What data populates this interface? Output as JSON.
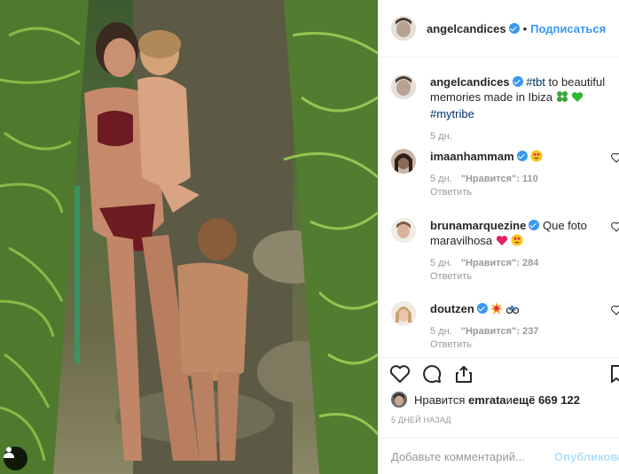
{
  "header": {
    "username": "angelcandices",
    "follow_label": "Подписаться",
    "separator": "•"
  },
  "caption": {
    "username": "angelcandices",
    "text_a": "#tbt",
    "text_b": " to beautiful memories made in Ibiza",
    "text_c": "#mytribe",
    "time": "5 дн."
  },
  "comments": [
    {
      "username": "imaanhammam",
      "text": "",
      "time": "5 дн.",
      "likes": "\"Нравится\": 110",
      "reply": "Ответить"
    },
    {
      "username": "brunamarquezine",
      "text": "Que foto maravilhosa",
      "time": "5 дн.",
      "likes": "\"Нравится\": 284",
      "reply": "Ответить"
    },
    {
      "username": "doutzen",
      "text": "",
      "time": "5 дн.",
      "likes": "\"Нравится\": 237",
      "reply": "Ответить"
    }
  ],
  "likes": {
    "prefix": "Нравится",
    "user": "emrata",
    "middle": " и ",
    "rest": "ещё 669 122"
  },
  "timestamp": "5 ДНЕЙ НАЗАД",
  "add_comment": {
    "placeholder": "Добавьте комментарий...",
    "publish_label": "Опубликовать"
  },
  "icons": [
    "heart-icon",
    "comment-icon",
    "share-icon",
    "bookmark-icon",
    "user-tag-icon",
    "verified-badge-icon"
  ],
  "colors": {
    "link": "#3897f0",
    "hashtag": "#003569",
    "muted": "#999999"
  }
}
